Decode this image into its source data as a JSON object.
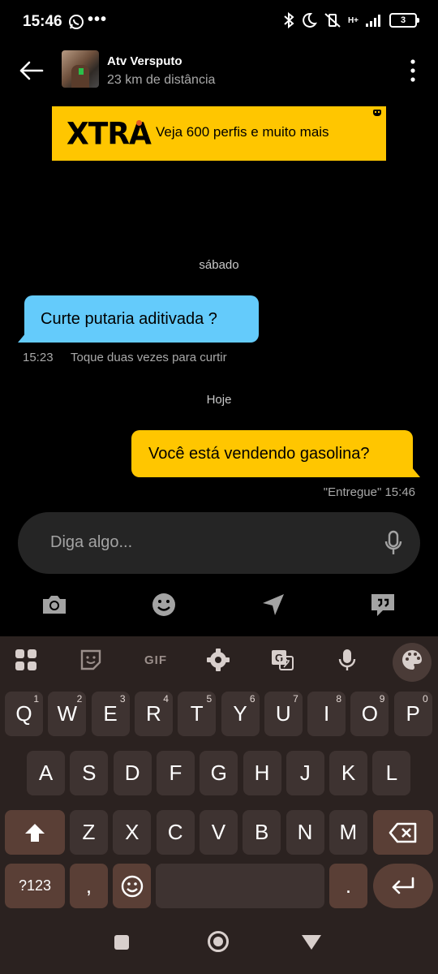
{
  "status_bar": {
    "time": "15:46",
    "overflow": "•••",
    "network": "H+",
    "battery": "3"
  },
  "header": {
    "contact_name": "Atv Versputo",
    "distance": "23 km de distância"
  },
  "ad": {
    "logo": "XTRA",
    "text": "Veja 600 perfis e muito mais"
  },
  "chat": {
    "day1": "sábado",
    "incoming": {
      "text": "Curte putaria aditivada ?",
      "time": "15:23",
      "hint": "Toque duas vezes para curtir"
    },
    "day2": "Hoje",
    "outgoing": {
      "text": "Você está vendendo gasolina?",
      "status": "\"Entregue\" 15:46"
    }
  },
  "composer": {
    "placeholder": "Diga algo..."
  },
  "keyboard": {
    "toolbar_gif": "GIF",
    "row1": [
      {
        "k": "Q",
        "n": "1"
      },
      {
        "k": "W",
        "n": "2"
      },
      {
        "k": "E",
        "n": "3"
      },
      {
        "k": "R",
        "n": "4"
      },
      {
        "k": "T",
        "n": "5"
      },
      {
        "k": "Y",
        "n": "6"
      },
      {
        "k": "U",
        "n": "7"
      },
      {
        "k": "I",
        "n": "8"
      },
      {
        "k": "O",
        "n": "9"
      },
      {
        "k": "P",
        "n": "0"
      }
    ],
    "row2": [
      "A",
      "S",
      "D",
      "F",
      "G",
      "H",
      "J",
      "K",
      "L"
    ],
    "row3": [
      "Z",
      "X",
      "C",
      "V",
      "B",
      "N",
      "M"
    ],
    "symbols": "?123",
    "comma": ",",
    "period": "."
  },
  "colors": {
    "incoming_bubble": "#64cbfb",
    "outgoing_bubble": "#ffc600",
    "keyboard_bg": "#2b2220"
  }
}
